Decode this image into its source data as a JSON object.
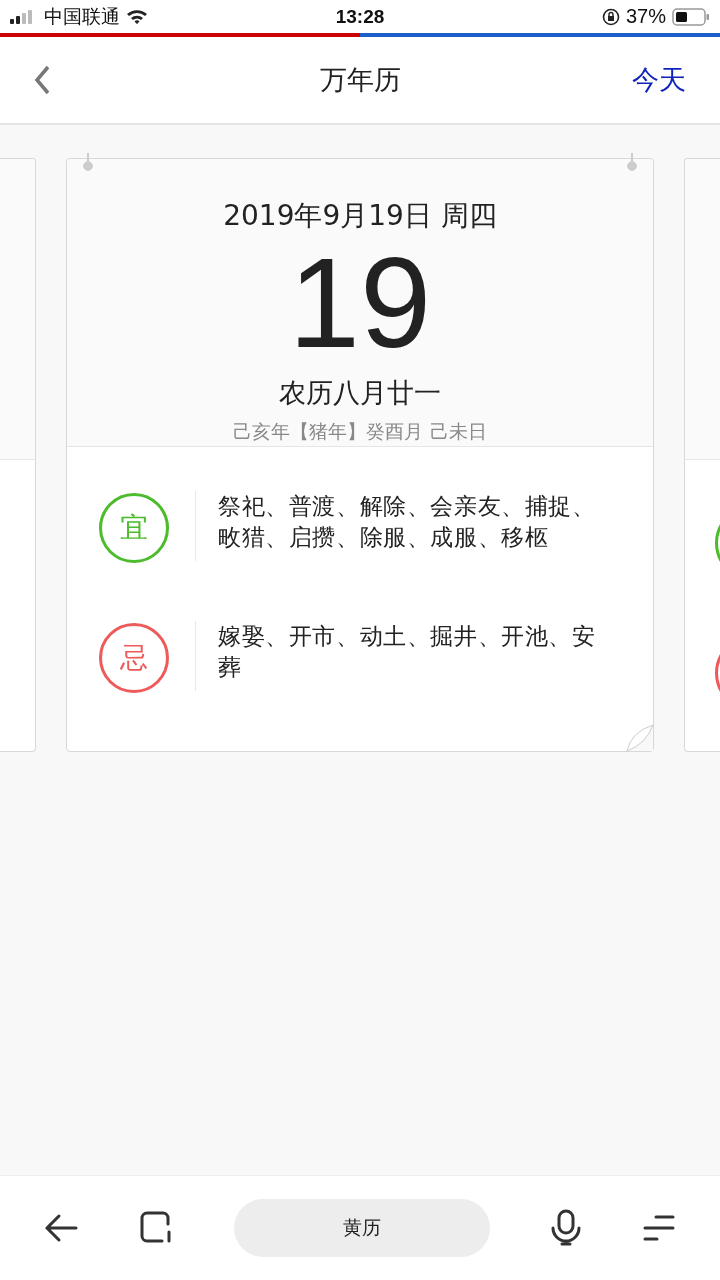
{
  "status_bar": {
    "carrier": "中国联通",
    "time": "13:28",
    "battery": "37%"
  },
  "nav": {
    "title": "万年历",
    "action": "今天"
  },
  "card": {
    "solar_date": "2019年9月19日 周四",
    "day": "19",
    "lunar_date": "农历八月廿一",
    "ganzhi": "己亥年【猪年】癸酉月 己未日",
    "rows": [
      {
        "badge": "宜",
        "color": "#4cbb2c",
        "text": "祭祀、普渡、解除、会亲友、捕捉、畋猎、启攒、除服、成服、移柩"
      },
      {
        "badge": "忌",
        "color": "#ee5a5a",
        "text": "嫁娶、开市、动土、掘井、开池、安葬"
      }
    ]
  },
  "bottom_bar": {
    "center": "黄历"
  }
}
